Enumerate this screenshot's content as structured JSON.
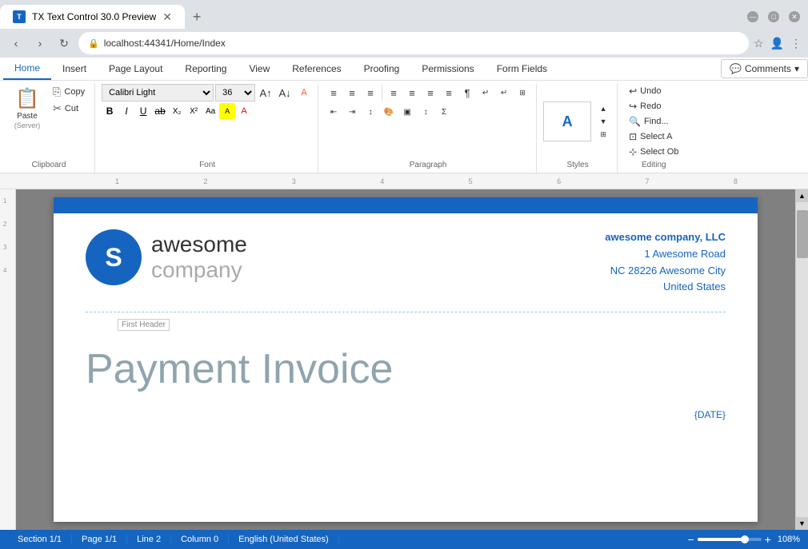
{
  "browser": {
    "tab_title": "TX Text Control 30.0 Preview",
    "url": "localhost:44341/Home/Index",
    "new_tab_symbol": "+",
    "minimize": "—",
    "maximize": "□",
    "close": "✕"
  },
  "ribbon": {
    "tabs": [
      "Home",
      "Insert",
      "Page Layout",
      "Reporting",
      "View",
      "References",
      "Proofing",
      "Permissions",
      "Form Fields"
    ],
    "active_tab": "Home",
    "comments_label": "Comments",
    "groups": {
      "clipboard": {
        "label": "Clipboard",
        "paste_label": "Paste",
        "paste_sub": "(Server)",
        "copy_label": "Copy",
        "cut_label": "Cut"
      },
      "font": {
        "label": "Font",
        "font_name": "Calibri Light",
        "font_size": "36",
        "bold": "B",
        "italic": "I",
        "underline": "U",
        "strikethrough": "ab",
        "subscript": "X₂",
        "superscript": "X²",
        "change_case": "Aa"
      },
      "paragraph": {
        "label": "Paragraph"
      },
      "styles": {
        "label": "Styles",
        "letter": "A"
      },
      "editing": {
        "label": "Editing",
        "undo": "Undo",
        "redo": "Redo",
        "find": "Find...",
        "select_all": "Select A",
        "select_objects": "Select Ob"
      }
    }
  },
  "document": {
    "company": {
      "logo_letter": "S",
      "name_top": "awesome",
      "name_bottom": "company",
      "address_name": "awesome company, LLC",
      "address_line1": "1 Awesome Road",
      "address_line2": "NC 28226 Awesome City",
      "address_line3": "United States"
    },
    "header_label": "First Header",
    "title": "Payment Invoice",
    "date_field": "{DATE}"
  },
  "status_bar": {
    "section": "Section 1/1",
    "page": "Page 1/1",
    "line": "Line 2",
    "column": "Column 0",
    "language": "English (United States)",
    "zoom": "108%"
  }
}
